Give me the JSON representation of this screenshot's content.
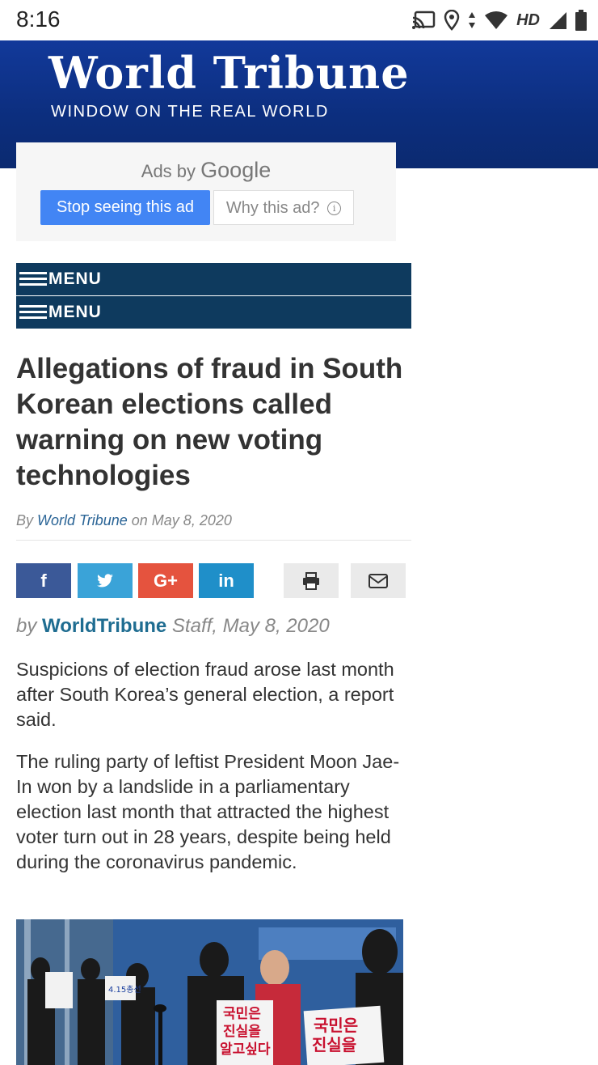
{
  "status_bar": {
    "time": "8:16",
    "network_label": "HD",
    "icons": [
      "cast-icon",
      "location-icon",
      "data-arrows-icon",
      "wifi-icon",
      "signal-icon",
      "battery-icon"
    ]
  },
  "header": {
    "logo": "World Tribune",
    "tagline": "WINDOW ON THE REAL WORLD",
    "colors": {
      "banner": "#0c2e7e"
    }
  },
  "ad": {
    "ads_by": "Ads by",
    "ads_brand": "Google",
    "stop_button": "Stop seeing this ad",
    "why_button": "Why this ad?",
    "colors": {
      "stop_button": "#4285f4"
    }
  },
  "menus": [
    {
      "label": "MENU"
    },
    {
      "label": "MENU"
    }
  ],
  "article": {
    "headline": "Allegations of fraud in South Korean elections called warning on new voting technologies",
    "byline_prefix": "By",
    "byline_author": "World Tribune",
    "byline_on": "on",
    "byline_date": "May 8, 2020",
    "share_buttons": [
      {
        "icon": "facebook-icon",
        "label": "f"
      },
      {
        "icon": "twitter-icon"
      },
      {
        "icon": "google-plus-icon",
        "label": "G+"
      },
      {
        "icon": "linkedin-icon",
        "label": "in"
      },
      {
        "icon": "print-icon"
      },
      {
        "icon": "email-icon"
      }
    ],
    "author_prefix": "by",
    "author_name": "WorldTribune",
    "author_suffix": "Staff, May 8, 2020",
    "paragraphs": [
      "Suspicions of election fraud arose last month after South Korea’s general election, a report said.",
      "The ruling party of leftist President Moon Jae-In won by a landslide in a parliamentary election last month that attracted the highest voter turn out in 28 years, despite being held during the coronavirus pandemic."
    ],
    "photo_signs": [
      "국민은",
      "진실을",
      "알고싶다",
      "4.15총선",
      "국민은",
      "진실을"
    ]
  }
}
